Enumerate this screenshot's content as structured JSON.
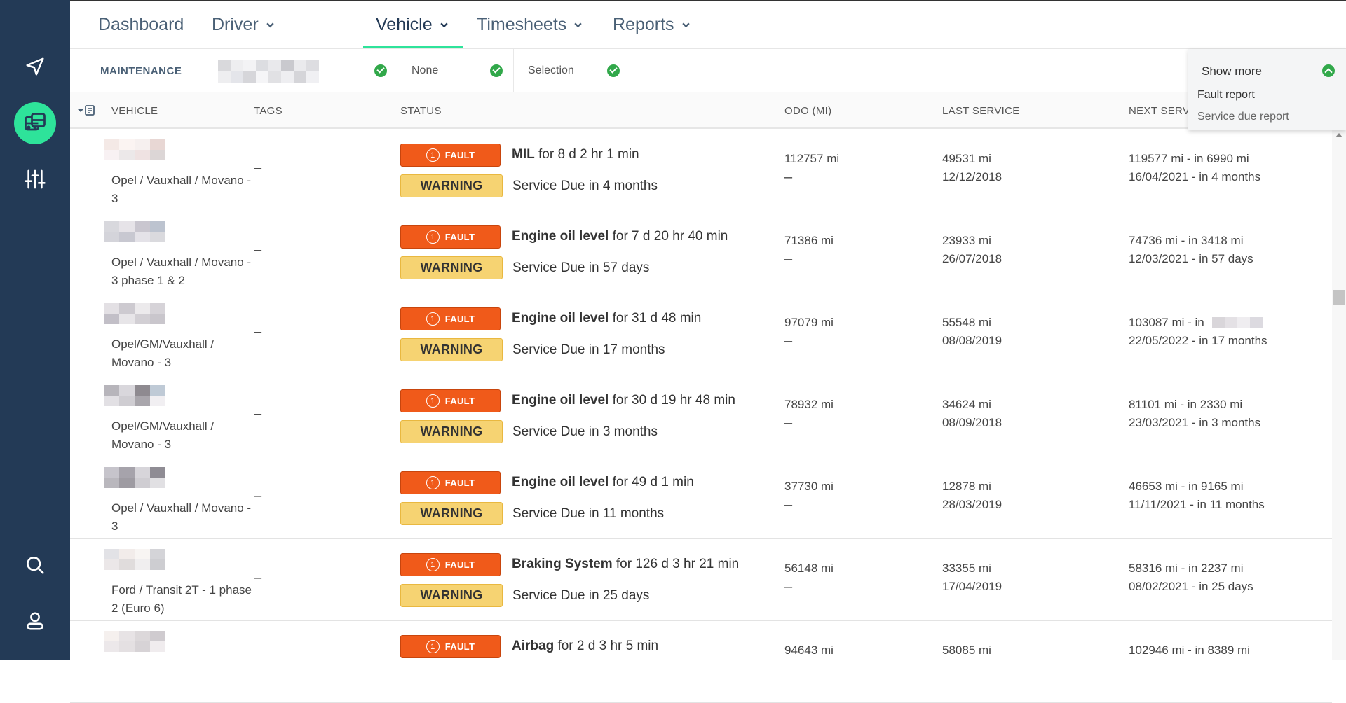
{
  "nav": {
    "items": [
      {
        "label": "Dashboard"
      },
      {
        "label": "Driver"
      },
      {
        "label": "Vehicle"
      },
      {
        "label": "Timesheets"
      },
      {
        "label": "Reports"
      }
    ]
  },
  "sidebar": {
    "icons": [
      "navigation-arrow-icon",
      "vehicle-bus-icon",
      "sliders-icon",
      "search-icon",
      "user-icon"
    ]
  },
  "filters": {
    "label": "MAINTENANCE",
    "filter2": "None",
    "filter3": "Selection"
  },
  "dropdown": {
    "title": "Show more",
    "items": [
      "Fault report",
      "Service due report"
    ]
  },
  "table": {
    "columns": [
      "VEHICLE",
      "TAGS",
      "STATUS",
      "ODO (MI)",
      "LAST SERVICE",
      "NEXT SERV"
    ],
    "fault_badge": "FAULT",
    "fault_badge_num": "1",
    "warning_badge": "WARNING",
    "rows": [
      {
        "name": "Opel / Vauxhall / Movano - 3",
        "tags": "–",
        "fault_item": "MIL",
        "fault_duration": " for 8 d 2 hr 1 min",
        "warning": "Service Due in 4 months",
        "odo": "112757 mi",
        "odo2": "–",
        "last_mi": "49531 mi",
        "last_date": "12/12/2018",
        "next_mi": "119577 mi - in 6990 mi",
        "next_date": "16/04/2021 - in 4 months"
      },
      {
        "name": "Opel / Vauxhall / Movano - 3 phase 1 & 2",
        "tags": "–",
        "fault_item": "Engine oil level",
        "fault_duration": " for 7 d 20 hr 40 min",
        "warning": "Service Due in 57 days",
        "odo": "71386 mi",
        "odo2": "–",
        "last_mi": "23933 mi",
        "last_date": "26/07/2018",
        "next_mi": "74736 mi - in 3418 mi",
        "next_date": "12/03/2021 - in 57 days"
      },
      {
        "name": "Opel/GM/Vauxhall / Movano - 3",
        "tags": "–",
        "fault_item": "Engine oil level",
        "fault_duration": " for 31 d 48 min",
        "warning": "Service Due in 17 months",
        "odo": "97079 mi",
        "odo2": "–",
        "last_mi": "55548 mi",
        "last_date": "08/08/2019",
        "next_mi": "103087 mi - in",
        "next_date": "22/05/2022 - in 17 months"
      },
      {
        "name": "Opel/GM/Vauxhall / Movano - 3",
        "tags": "–",
        "fault_item": "Engine oil level",
        "fault_duration": " for 30 d 19 hr 48 min",
        "warning": "Service Due in 3 months",
        "odo": "78932 mi",
        "odo2": "–",
        "last_mi": "34624 mi",
        "last_date": "08/09/2018",
        "next_mi": "81101 mi - in 2330 mi",
        "next_date": "23/03/2021 - in 3 months"
      },
      {
        "name": "Opel / Vauxhall / Movano - 3",
        "tags": "–",
        "fault_item": "Engine oil level",
        "fault_duration": " for 49 d 1 min",
        "warning": "Service Due in 11 months",
        "odo": "37730 mi",
        "odo2": "–",
        "last_mi": "12878 mi",
        "last_date": "28/03/2019",
        "next_mi": "46653 mi - in 9165 mi",
        "next_date": "11/11/2021 - in 11 months"
      },
      {
        "name": "Ford / Transit 2T - 1 phase 2 (Euro 6)",
        "tags": "–",
        "fault_item": "Braking System",
        "fault_duration": " for 126 d 3 hr 21 min",
        "warning": "Service Due in 25 days",
        "odo": "56148 mi",
        "odo2": "–",
        "last_mi": "33355 mi",
        "last_date": "17/04/2019",
        "next_mi": "58316 mi - in 2237 mi",
        "next_date": "08/02/2021 - in 25 days"
      },
      {
        "name": "",
        "tags": "",
        "fault_item": "Airbag",
        "fault_duration": " for 2 d 3 hr 5 min",
        "warning": "",
        "odo": "94643 mi",
        "odo2": "",
        "last_mi": "58085 mi",
        "last_date": "",
        "next_mi": "102946 mi - in 8389 mi",
        "next_date": ""
      }
    ]
  },
  "colors": {
    "sidebar": "#233a56",
    "accent": "#2ee39a",
    "fault": "#f05a1a",
    "warning": "#f6d372",
    "check": "#31a84a"
  }
}
